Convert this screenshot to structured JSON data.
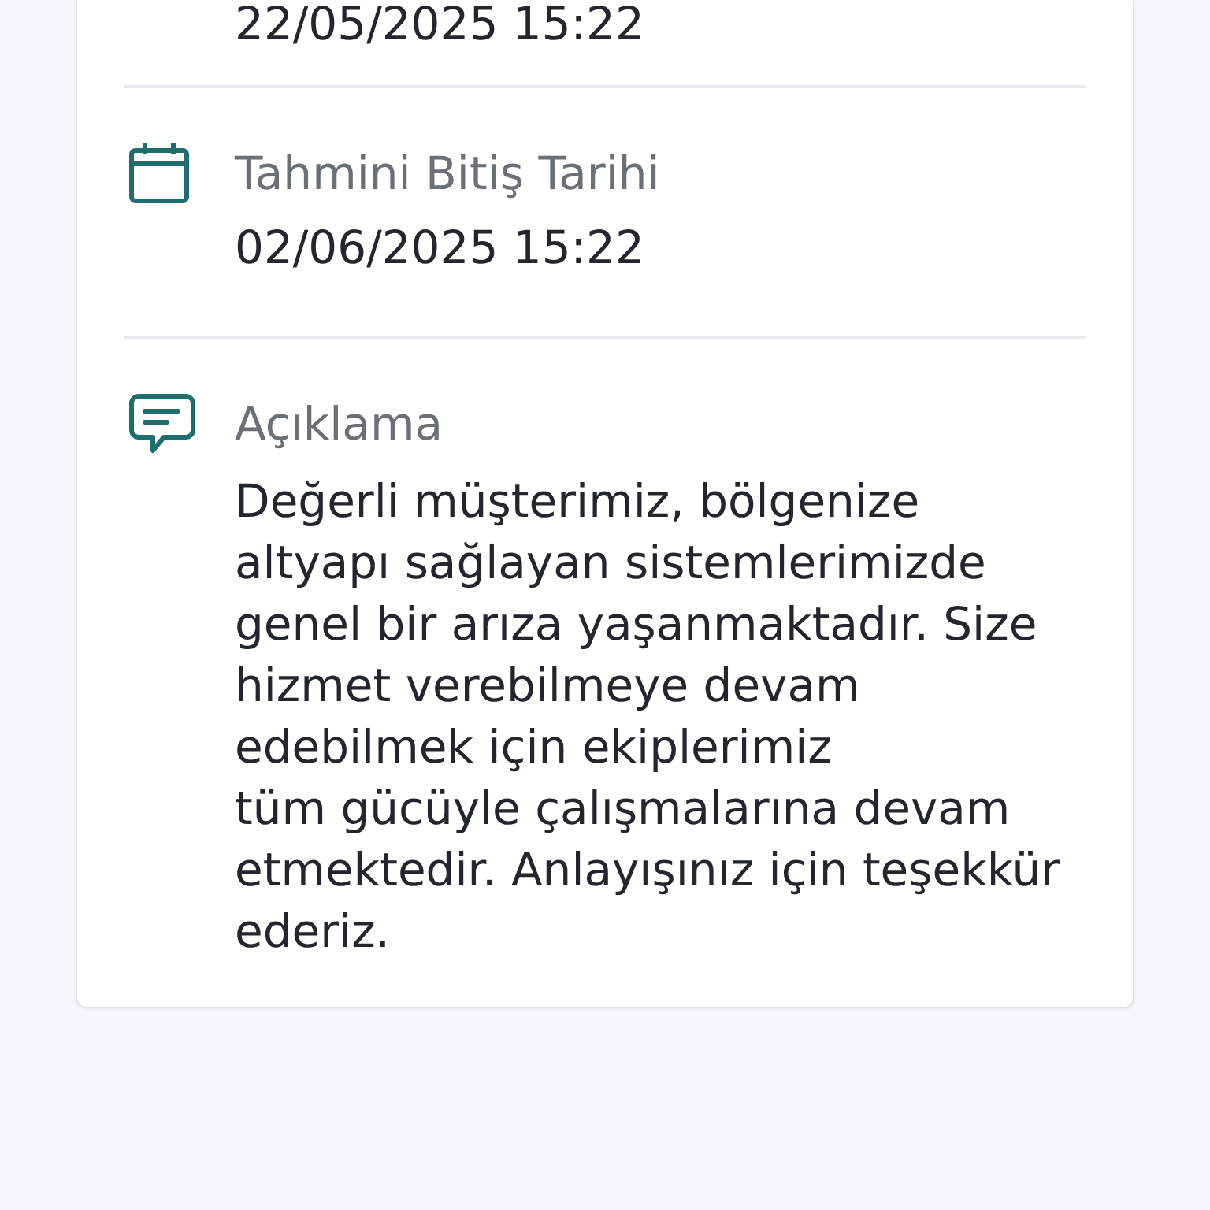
{
  "card": {
    "top_value": "22/05/2025 15:22",
    "fields": [
      {
        "kind": "date",
        "label": "Tahmini Bitiş Tarihi",
        "value": "02/06/2025 15:22"
      },
      {
        "kind": "note",
        "label": "Açıklama",
        "value": "Değerli müşterimiz, bölgenize altyapı sağlayan sistemlerimizde genel bir arıza yaşanmaktadır. Size hizmet verebilmeye devam edebilmek için ekiplerimiz\ntüm gücüyle çalışmalarına devam etmektedir. Anlayışınız için teşekkür ederiz."
      }
    ]
  }
}
